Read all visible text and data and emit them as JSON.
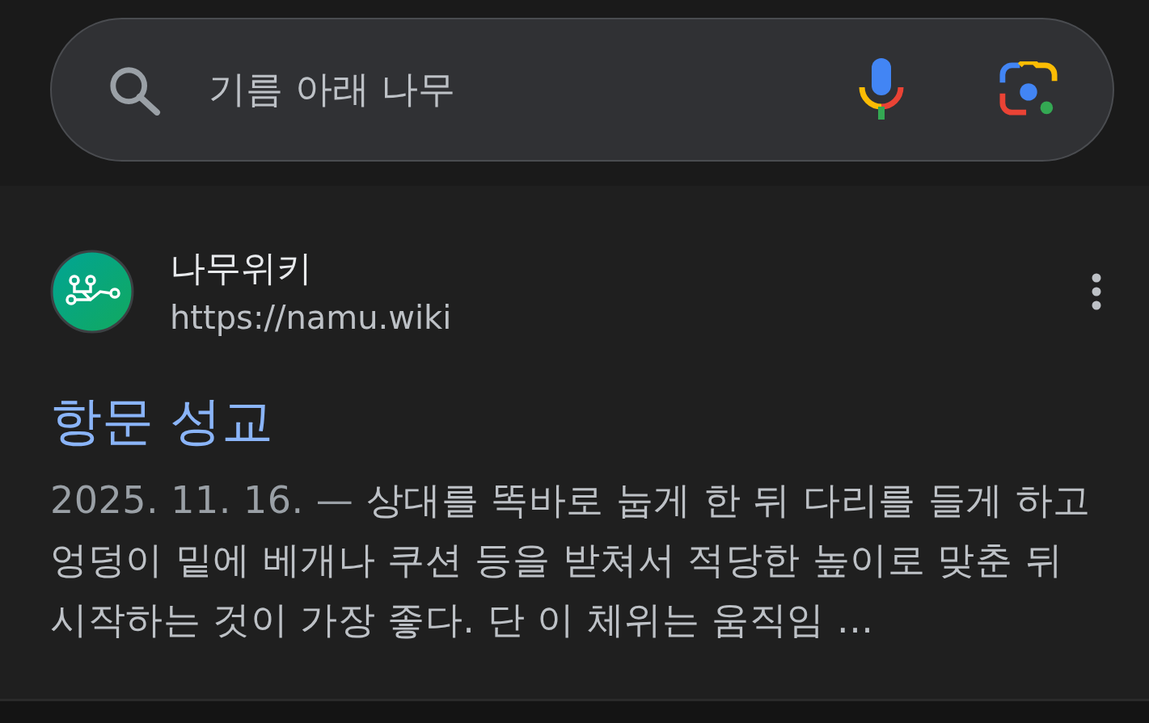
{
  "search": {
    "value": "기름 아래 나무"
  },
  "result": {
    "site_name": "나무위키",
    "url": "https://namu.wiki",
    "title": "항문 성교",
    "date": "2025. 11. 16. —",
    "snippet": "상대를 똑바로 눕게 한 뒤 다리를 들게 하고 엉덩이 밑에 베개나 쿠션 등을 받쳐서 적당한 높이로 맞춘 뒤 시작하는 것이 가장 좋다. 단 이 체위는 움직임 ..."
  }
}
